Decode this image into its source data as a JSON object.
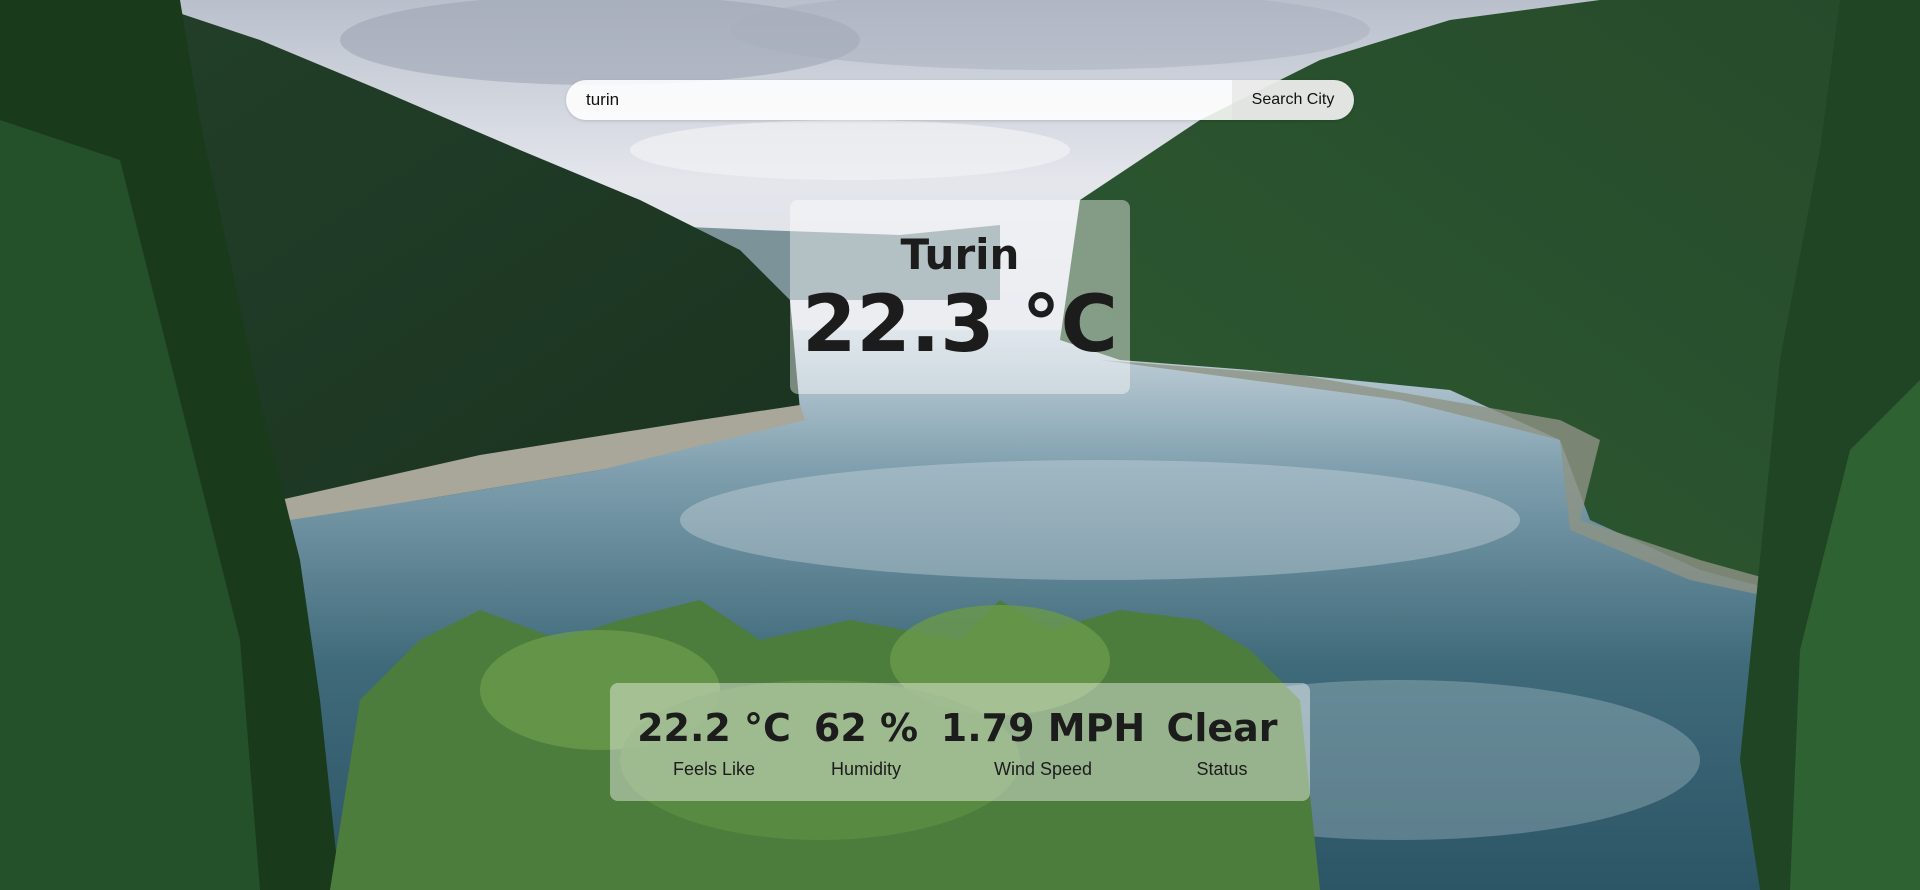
{
  "search": {
    "value": "turin",
    "button_label": "Search City"
  },
  "weather": {
    "city": "Turin",
    "temperature": "22.3 °C"
  },
  "details": [
    {
      "value": "22.2 °C",
      "label": "Feels Like"
    },
    {
      "value": "62 %",
      "label": "Humidity"
    },
    {
      "value": "1.79 MPH",
      "label": "Wind Speed"
    },
    {
      "value": "Clear",
      "label": "Status"
    }
  ],
  "colors": {
    "text": "#1c1c1c",
    "card_background": "rgba(255,255,255,0.42)",
    "forest_dark": "#1f3a22",
    "lake": "#3d6b7a",
    "sky": "#dfe3ea"
  },
  "background": {
    "scene": "forest-lake-landscape"
  }
}
